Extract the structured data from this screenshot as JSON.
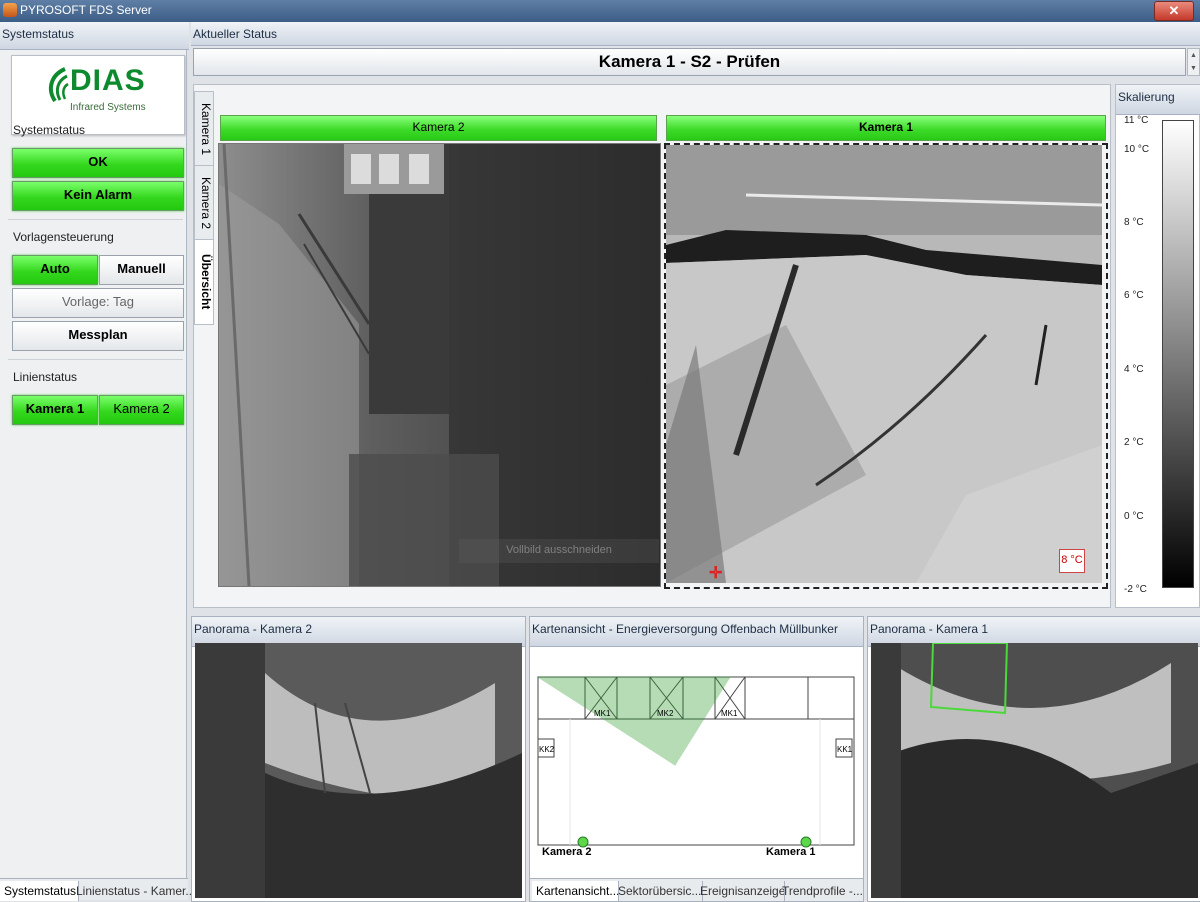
{
  "window": {
    "title": "PYROSOFT FDS Server",
    "close_glyph": "✕"
  },
  "left": {
    "header": "Systemstatus",
    "logo": {
      "name": "DIAS",
      "subtitle": "Infrared Systems"
    },
    "systemstatus": {
      "label": "Systemstatus",
      "ok": "OK",
      "alarm": "Kein Alarm"
    },
    "vorlagen": {
      "label": "Vorlagensteuerung",
      "auto": "Auto",
      "manuell": "Manuell",
      "vorlage": "Vorlage: Tag",
      "messplan": "Messplan"
    },
    "linien": {
      "label": "Linienstatus",
      "cam1": "Kamera 1",
      "cam2": "Kamera 2"
    },
    "bottom_tabs": [
      "Systemstatus",
      "Linienstatus - Kamer..."
    ]
  },
  "main": {
    "header": "Aktueller Status",
    "status_title": "Kamera 1 - S2 - Prüfen",
    "vtabs": [
      "Kamera 1",
      "Kamera 2",
      "Übersicht"
    ],
    "cam_left": {
      "title": "Kamera 2",
      "overlay": "Vollbild ausschneiden"
    },
    "cam_right": {
      "title": "Kamera 1",
      "temp": "8 °C"
    }
  },
  "scale": {
    "header": "Skalierung",
    "ticks": [
      "11 °C",
      "10 °C",
      "8 °C",
      "6 °C",
      "4 °C",
      "2 °C",
      "0 °C",
      "-2 °C"
    ]
  },
  "bottom": {
    "pano2": {
      "title": "Panorama - Kamera 2"
    },
    "map": {
      "title": "Kartenansicht - Energieversorgung Offenbach Müllbunker",
      "labels": {
        "mk1a": "MK1",
        "mk2": "MK2",
        "mk1b": "MK1",
        "kk2": "KK2",
        "kk1": "KK1",
        "cam2": "Kamera 2",
        "cam1": "Kamera 1"
      },
      "tabs": [
        "Kartenansicht...",
        "Sektorübersic...",
        "Ereignisanzeige",
        "Trendprofile -..."
      ]
    },
    "pano1": {
      "title": "Panorama - Kamera 1"
    }
  },
  "colors": {
    "accent_green": "#35d81f",
    "titlebar": "#3c5d86",
    "temp_badge": "#cc0000"
  }
}
